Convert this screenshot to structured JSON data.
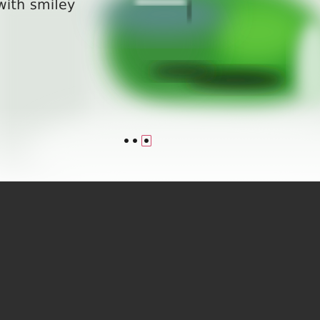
{
  "hero": {
    "caption": "with smiley",
    "image": "blurred-green-background-image"
  },
  "pager": {
    "dots": [
      {
        "state": "inactive"
      },
      {
        "state": "inactive"
      },
      {
        "state": "active"
      }
    ],
    "active_index": 2
  },
  "colors": {
    "page_background": "#2f2f2f",
    "focus_outline": "#d24b6e",
    "dot": "#1b1b1b"
  }
}
